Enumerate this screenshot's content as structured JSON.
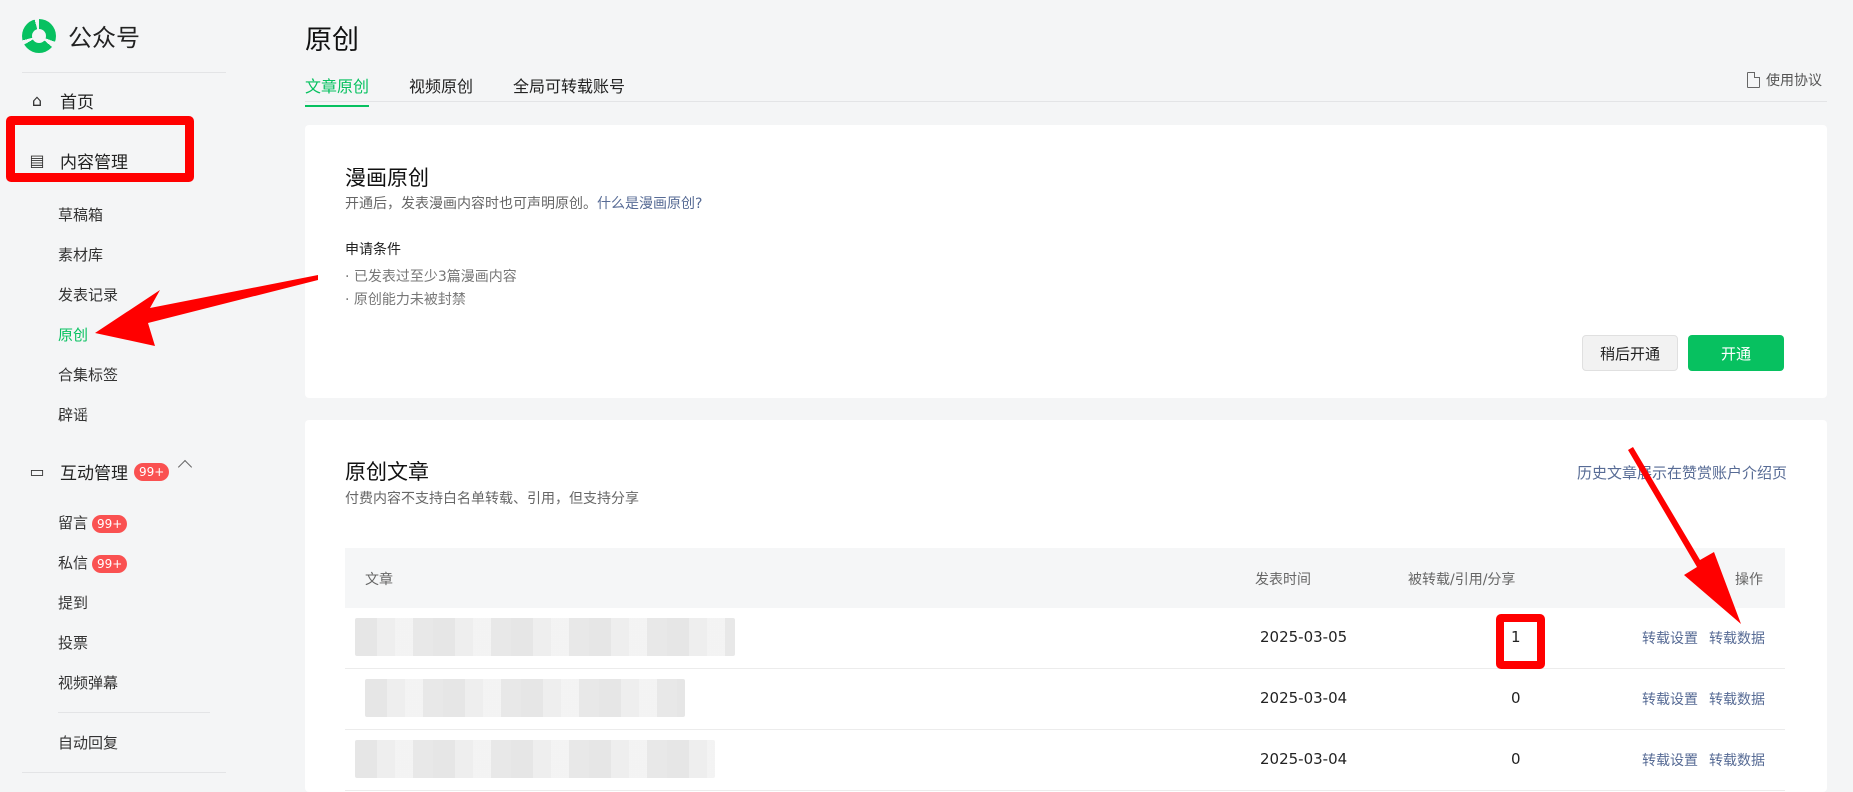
{
  "sidebar": {
    "app_name": "公众号",
    "home": "首页",
    "content_mgmt": "内容管理",
    "content_items": [
      "草稿箱",
      "素材库",
      "发表记录",
      "原创",
      "合集标签",
      "辟谣"
    ],
    "interaction_mgmt": "互动管理",
    "interaction_badge": "99+",
    "interaction_items": [
      {
        "label": "留言",
        "badge": "99+"
      },
      {
        "label": "私信",
        "badge": "99+"
      },
      {
        "label": "提到",
        "badge": ""
      },
      {
        "label": "投票",
        "badge": ""
      },
      {
        "label": "视频弹幕",
        "badge": ""
      }
    ],
    "auto_reply": "自动回复"
  },
  "header": {
    "title": "原创",
    "tabs": [
      "文章原创",
      "视频原创",
      "全局可转载账号"
    ],
    "agreement": "使用协议"
  },
  "comic_card": {
    "title": "漫画原创",
    "desc": "开通后，发表漫画内容时也可声明原创。",
    "desc_link": "什么是漫画原创?",
    "cond_title": "申请条件",
    "conditions": [
      "· 已发表过至少3篇漫画内容",
      "· 原创能力未被封禁"
    ],
    "later_button": "稍后开通",
    "open_button": "开通"
  },
  "articles_card": {
    "title": "原创文章",
    "desc": "付费内容不支持白名单转载、引用，但支持分享",
    "link": "历史文章展示在赞赏账户介绍页",
    "columns": {
      "article": "文章",
      "time": "发表时间",
      "stats": "被转载/引用/分享",
      "ops": "操作"
    },
    "rows": [
      {
        "time": "2025-03-05",
        "stats": "1",
        "op1": "转载设置",
        "op2": "转载数据"
      },
      {
        "time": "2025-03-04",
        "stats": "0",
        "op1": "转载设置",
        "op2": "转载数据"
      },
      {
        "time": "2025-03-04",
        "stats": "0",
        "op1": "转载设置",
        "op2": "转载数据"
      }
    ]
  },
  "colors": {
    "accent": "#07c160",
    "link": "#576b95",
    "badge": "#fa5151",
    "annotation": "#ff0000"
  }
}
